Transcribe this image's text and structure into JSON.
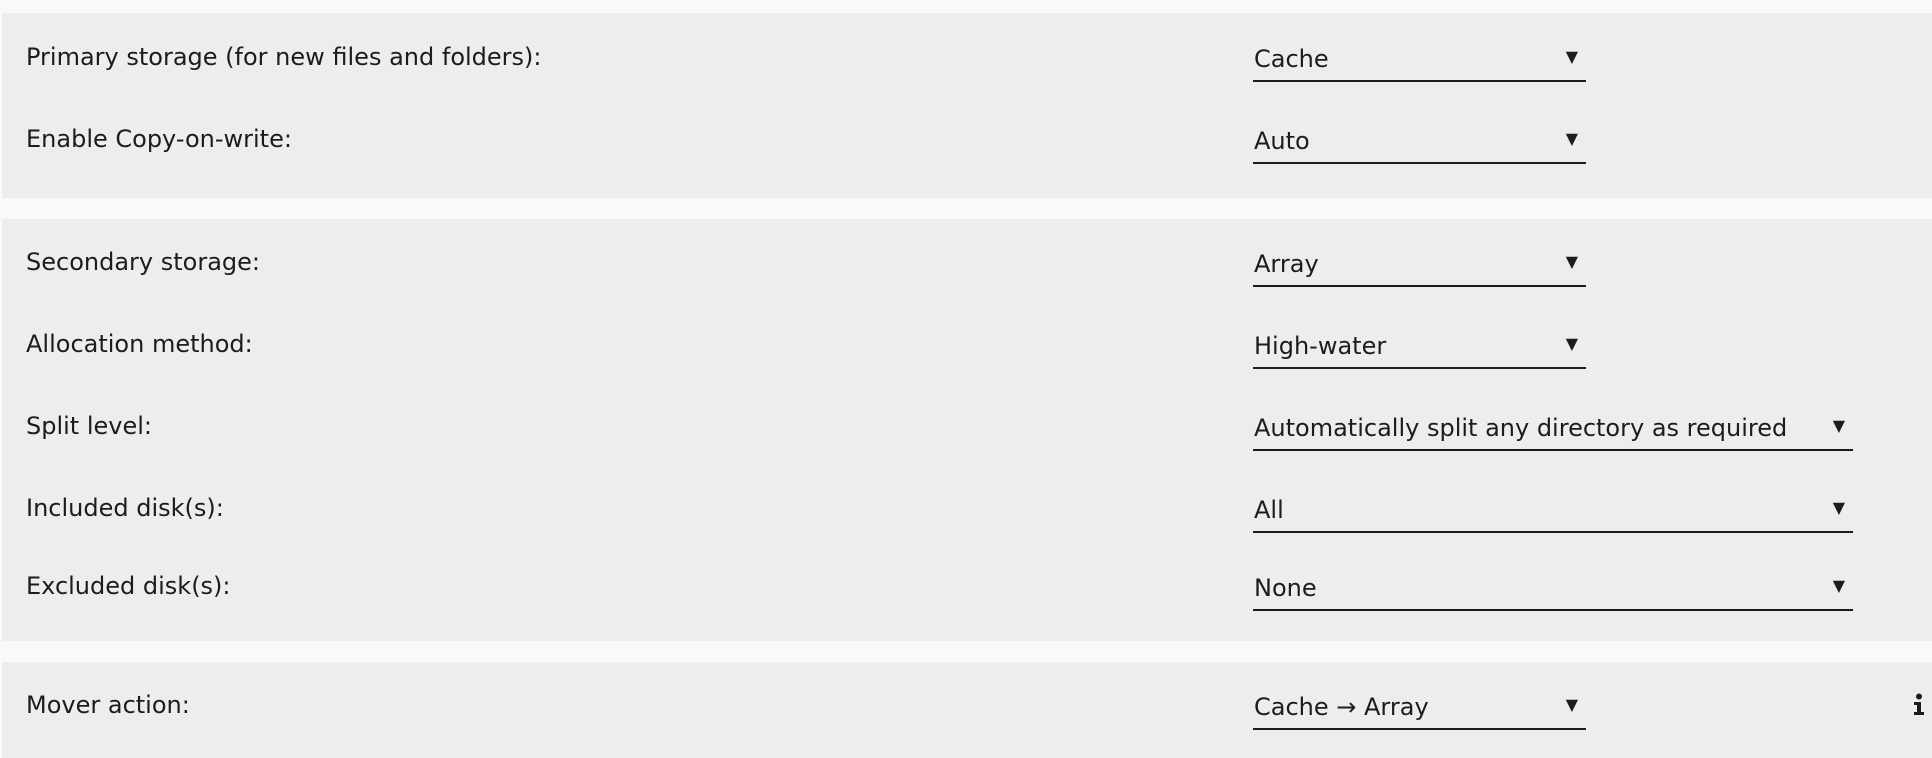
{
  "sections": {
    "primary": {
      "primary_storage": {
        "label": "Primary storage (for new files and folders):",
        "value": "Cache"
      },
      "copy_on_write": {
        "label": "Enable Copy-on-write:",
        "value": "Auto"
      }
    },
    "secondary": {
      "secondary_storage": {
        "label": "Secondary storage:",
        "value": "Array"
      },
      "allocation_method": {
        "label": "Allocation method:",
        "value": "High-water"
      },
      "split_level": {
        "label": "Split level:",
        "value": "Automatically split any directory as required"
      },
      "included_disks": {
        "label": "Included disk(s):",
        "value": "All"
      },
      "excluded_disks": {
        "label": "Excluded disk(s):",
        "value": "None"
      }
    },
    "mover": {
      "mover_action": {
        "label": "Mover action:",
        "value": "Cache → Array"
      }
    }
  },
  "icons": {
    "dropdown": "caret-down-icon",
    "info": "info-icon"
  },
  "colors": {
    "page_background": "#f9f9f9",
    "section_background": "#ededed",
    "text": "#1c1c1c"
  }
}
